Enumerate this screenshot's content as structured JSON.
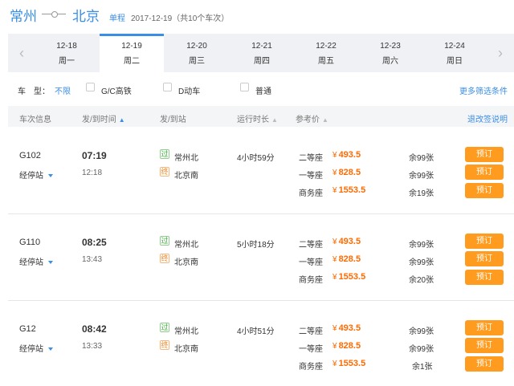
{
  "header": {
    "from": "常州",
    "to": "北京",
    "trip_type": "单程",
    "date_info": "2017-12-19（共10个车次）"
  },
  "dates": [
    {
      "date": "12-18",
      "weekday": "周一",
      "active": false
    },
    {
      "date": "12-19",
      "weekday": "周二",
      "active": true
    },
    {
      "date": "12-20",
      "weekday": "周三",
      "active": false
    },
    {
      "date": "12-21",
      "weekday": "周四",
      "active": false
    },
    {
      "date": "12-22",
      "weekday": "周五",
      "active": false
    },
    {
      "date": "12-23",
      "weekday": "周六",
      "active": false
    },
    {
      "date": "12-24",
      "weekday": "周日",
      "active": false
    }
  ],
  "nav": {
    "prev": "‹",
    "next": "›"
  },
  "filter": {
    "label": "车　型：",
    "no_limit": "不限",
    "options": [
      "G/C高铁",
      "D动车",
      "普通"
    ],
    "more": "更多筛选条件"
  },
  "table_header": {
    "train_info": "车次信息",
    "time": "发/到时间",
    "time_sort": "▲",
    "station": "发/到站",
    "duration": "运行时长",
    "duration_sort": "▲",
    "price": "参考价",
    "price_sort": "▲",
    "refund": "退改签说明"
  },
  "trains": [
    {
      "no": "G102",
      "stops": "经停站",
      "dep_time": "07:19",
      "arr_time": "12:18",
      "pass_tag": "过",
      "dep_station": "常州北",
      "end_tag": "终",
      "arr_station": "北京南",
      "duration": "4小时59分",
      "seats": [
        {
          "name": "二等座",
          "yen": "¥",
          "price": "493.5",
          "remain": "余99张",
          "book": "预订"
        },
        {
          "name": "一等座",
          "yen": "¥",
          "price": "828.5",
          "remain": "余99张",
          "book": "预订"
        },
        {
          "name": "商务座",
          "yen": "¥",
          "price": "1553.5",
          "remain": "余19张",
          "book": "预订"
        }
      ]
    },
    {
      "no": "G110",
      "stops": "经停站",
      "dep_time": "08:25",
      "arr_time": "13:43",
      "pass_tag": "过",
      "dep_station": "常州北",
      "end_tag": "终",
      "arr_station": "北京南",
      "duration": "5小时18分",
      "seats": [
        {
          "name": "二等座",
          "yen": "¥",
          "price": "493.5",
          "remain": "余99张",
          "book": "预订"
        },
        {
          "name": "一等座",
          "yen": "¥",
          "price": "828.5",
          "remain": "余99张",
          "book": "预订"
        },
        {
          "name": "商务座",
          "yen": "¥",
          "price": "1553.5",
          "remain": "余20张",
          "book": "预订"
        }
      ]
    },
    {
      "no": "G12",
      "stops": "经停站",
      "dep_time": "08:42",
      "arr_time": "13:33",
      "pass_tag": "过",
      "dep_station": "常州北",
      "end_tag": "终",
      "arr_station": "北京南",
      "duration": "4小时51分",
      "seats": [
        {
          "name": "二等座",
          "yen": "¥",
          "price": "493.5",
          "remain": "余99张",
          "book": "预订"
        },
        {
          "name": "一等座",
          "yen": "¥",
          "price": "828.5",
          "remain": "余99张",
          "book": "预订"
        },
        {
          "name": "商务座",
          "yen": "¥",
          "price": "1553.5",
          "remain": "余1张",
          "book": "预订"
        }
      ]
    }
  ],
  "colors": {
    "accent": "#3a8ee6",
    "price": "#ff6a00",
    "book_button": "#ff9c1f"
  }
}
